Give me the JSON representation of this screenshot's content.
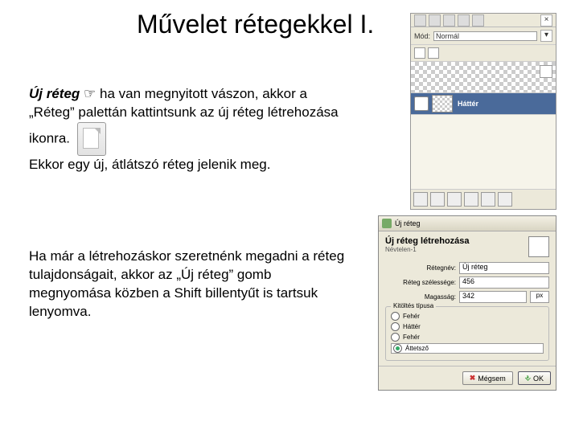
{
  "title": "Művelet rétegekkel I.",
  "para1_lead": "Új réteg",
  "para1_pointer": " ☞ ",
  "para1_rest": "ha van megnyitott vászon, akkor a „Réteg” palettán kattintsunk az új réteg létrehozása ikonra.",
  "para1_line2": "Ekkor egy új, átlátszó réteg jelenik meg.",
  "para2": "Ha már a létrehozáskor szeretnénk megadni a réteg tulajdonságait, akkor az „Új réteg” gomb megnyomása közben a Shift billentyűt is tartsuk lenyomva.",
  "palette": {
    "mode_label": "Mód:",
    "mode_value": "Normál",
    "layer_name": "Háttér"
  },
  "dialog": {
    "window_title": "Új réteg",
    "heading": "Új réteg létrehozása",
    "subtitle": "Névtelen-1",
    "field_name_label": "Rétegnév:",
    "field_name_value": "Új réteg",
    "field_width_label": "Réteg szélessége:",
    "field_width_value": "456",
    "field_height_label": "Magasság:",
    "field_height_value": "342",
    "unit": "px",
    "group_legend": "Kitöltés típusa",
    "r1": "Fehér",
    "r2": "Háttér",
    "r3": "Fehér",
    "r4": "Áttetsző",
    "cancel": "Mégsem",
    "ok": "OK"
  }
}
